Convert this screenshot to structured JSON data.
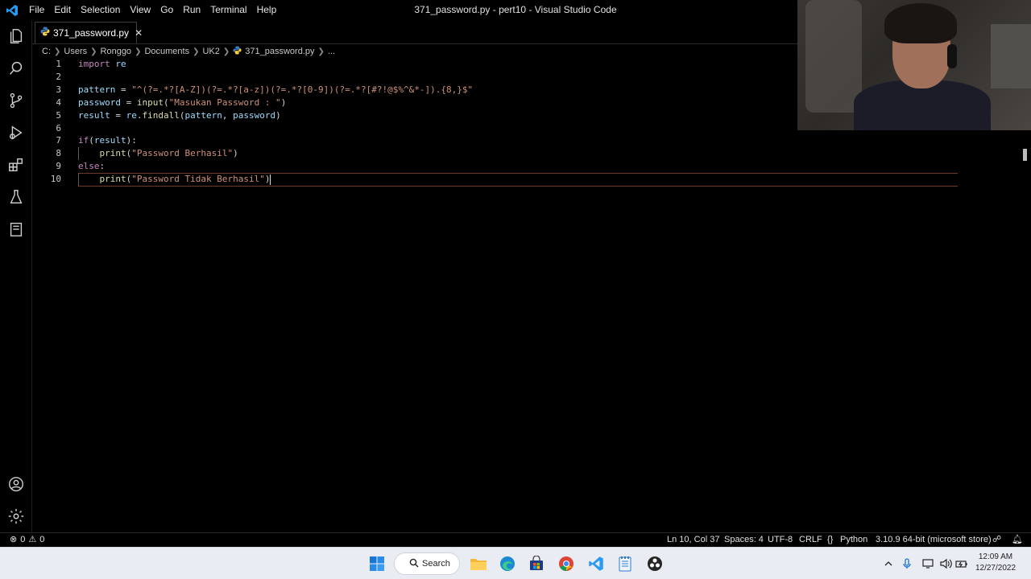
{
  "window": {
    "title": "371_password.py - pert10 - Visual Studio Code"
  },
  "menu": [
    "File",
    "Edit",
    "Selection",
    "View",
    "Go",
    "Run",
    "Terminal",
    "Help"
  ],
  "tab": {
    "label": "371_password.py",
    "close": "✕"
  },
  "breadcrumb": [
    "C:",
    "Users",
    "Ronggo",
    "Documents",
    "UK2",
    "371_password.py",
    "..."
  ],
  "editor": {
    "line_numbers": [
      "1",
      "2",
      "3",
      "4",
      "5",
      "6",
      "7",
      "8",
      "9",
      "10"
    ],
    "active_line": 10,
    "lines": [
      [
        {
          "t": "import",
          "c": "kw"
        },
        {
          "t": " re",
          "c": "id"
        }
      ],
      [],
      [
        {
          "t": "pattern",
          "c": "id"
        },
        {
          "t": " = ",
          "c": "op"
        },
        {
          "t": "\"^(?=.*?[A-Z])(?=.*?[a-z])(?=.*?[0-9])(?=.*?[#?!@$%^&*-]).{8,}$\"",
          "c": "str"
        }
      ],
      [
        {
          "t": "password",
          "c": "id"
        },
        {
          "t": " = ",
          "c": "op"
        },
        {
          "t": "input",
          "c": "fn"
        },
        {
          "t": "(",
          "c": "txt"
        },
        {
          "t": "\"Masukan Password : \"",
          "c": "str"
        },
        {
          "t": ")",
          "c": "txt"
        }
      ],
      [
        {
          "t": "result",
          "c": "id"
        },
        {
          "t": " = ",
          "c": "op"
        },
        {
          "t": "re",
          "c": "id"
        },
        {
          "t": ".",
          "c": "txt"
        },
        {
          "t": "findall",
          "c": "fn"
        },
        {
          "t": "(",
          "c": "txt"
        },
        {
          "t": "pattern",
          "c": "id"
        },
        {
          "t": ", ",
          "c": "txt"
        },
        {
          "t": "password",
          "c": "id"
        },
        {
          "t": ")",
          "c": "txt"
        }
      ],
      [],
      [
        {
          "t": "if",
          "c": "kw"
        },
        {
          "t": "(",
          "c": "txt"
        },
        {
          "t": "result",
          "c": "id"
        },
        {
          "t": "):",
          "c": "txt"
        }
      ],
      [
        {
          "t": "    ",
          "c": "txt"
        },
        {
          "t": "print",
          "c": "fn"
        },
        {
          "t": "(",
          "c": "txt"
        },
        {
          "t": "\"Password Berhasil\"",
          "c": "str"
        },
        {
          "t": ")",
          "c": "txt"
        }
      ],
      [
        {
          "t": "else",
          "c": "kw"
        },
        {
          "t": ":",
          "c": "txt"
        }
      ],
      [
        {
          "t": "    ",
          "c": "txt"
        },
        {
          "t": "print",
          "c": "fn"
        },
        {
          "t": "(",
          "c": "txt"
        },
        {
          "t": "\"Password Tidak Berhasil\"",
          "c": "str"
        },
        {
          "t": ")",
          "c": "txt"
        }
      ]
    ]
  },
  "statusbar": {
    "errors": "0",
    "warnings": "0",
    "position": "Ln 10, Col 37",
    "spaces": "Spaces: 4",
    "encoding": "UTF-8",
    "eol": "CRLF",
    "language": "Python",
    "interpreter": "3.10.9 64-bit (microsoft store)"
  },
  "taskbar": {
    "search_label": "Search",
    "time": "12:09 AM",
    "date": "12/27/2022"
  },
  "colors": {
    "keyword": "#c586c0",
    "identifier": "#9cdcfe",
    "function": "#dcdcaa",
    "string": "#ce9178",
    "vscode_blue": "#2b9af3",
    "active_line_border": "#6e3b2b"
  }
}
